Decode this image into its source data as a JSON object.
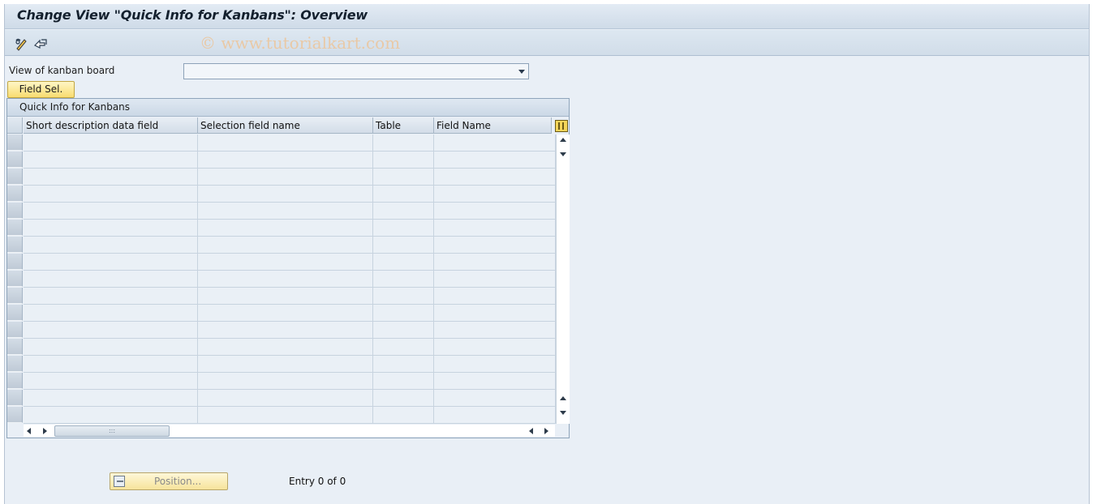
{
  "window": {
    "title": "Change View \"Quick Info for Kanbans\": Overview",
    "watermark": "© www.tutorialkart.com"
  },
  "toolbar": {
    "icons": [
      "display-change-icon",
      "other-view-icon"
    ]
  },
  "form": {
    "view_label": "View of kanban board",
    "view_value": "",
    "field_sel_label": "Field Sel."
  },
  "table": {
    "title": "Quick Info for Kanbans",
    "columns": [
      "Short description data field",
      "Selection field name",
      "Table",
      "Field Name"
    ],
    "row_count_visible": 17,
    "rows": []
  },
  "footer": {
    "position_label": "Position...",
    "entry_text": "Entry 0 of 0"
  },
  "colors": {
    "background": "#e9eff6",
    "button_yellow": "#f8dc70"
  }
}
